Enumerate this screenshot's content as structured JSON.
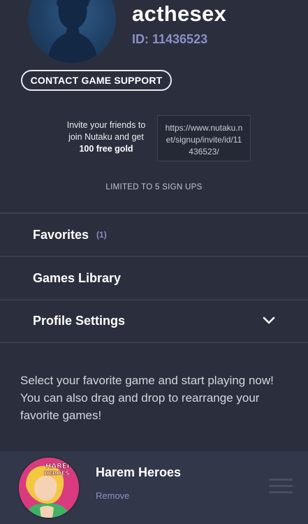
{
  "profile": {
    "username": "acthesex",
    "id_text": "ID: 11436523"
  },
  "support": {
    "button_label": "CONTACT GAME SUPPORT"
  },
  "invite": {
    "line1": "Invite your friends to",
    "line2": "join Nutaku and get",
    "bonus": "100 free gold",
    "link": "https://www.nutaku.net/signup/invite/id/11436523/",
    "limit": "LIMITED TO 5 SIGN UPS"
  },
  "menu": {
    "favorites_label": "Favorites",
    "favorites_count": "(1)",
    "library_label": "Games Library",
    "settings_label": "Profile Settings"
  },
  "favorites_help": "Select your favorite game and start playing now! You can also drag and drop to rearrange your favorite games!",
  "favorite_games": [
    {
      "title": "Harem Heroes",
      "remove_label": "Remove",
      "logo_text": "HAREM HEROES"
    }
  ],
  "icons": {
    "avatar": "avatar-silhouette-icon",
    "settings_toggle": "chevron-down-icon",
    "drag": "drag-handle-icon"
  },
  "colors": {
    "background": "#2b2f3d",
    "accent": "#8c8fc6",
    "game_row": "#32374a"
  }
}
